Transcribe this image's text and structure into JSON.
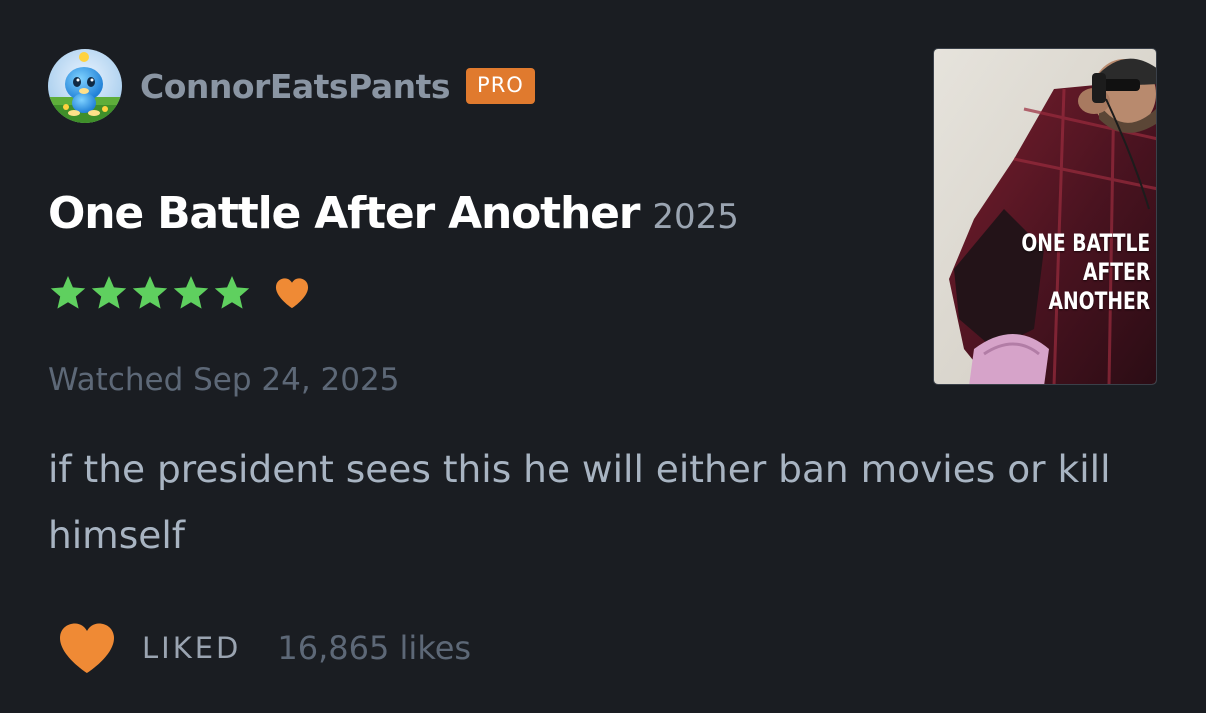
{
  "author": {
    "username": "ConnorEatsPants",
    "badge": "PRO",
    "avatar_icon": "chao-avatar-icon"
  },
  "film": {
    "title": "One Battle After Another",
    "year": "2025",
    "poster_lines": [
      "ONE BATTLE",
      "AFTER",
      "ANOTHER"
    ]
  },
  "rating": {
    "stars": 5,
    "max_stars": 5,
    "liked": true,
    "star_icon": "star-icon",
    "like_icon": "heart-icon"
  },
  "watched": "Watched Sep 24, 2025",
  "review": {
    "text": "if the president sees this he will either ban movies or kill himself"
  },
  "footer": {
    "liked_label": "LIKED",
    "likes_count": "16,865 likes"
  },
  "colors": {
    "background": "#1a1d22",
    "star": "#5fd05f",
    "heart": "#ef8a35",
    "badge": "#e07a2e",
    "username": "#8a95a3",
    "muted": "#5d6877",
    "body_text": "#a8b4c2"
  }
}
